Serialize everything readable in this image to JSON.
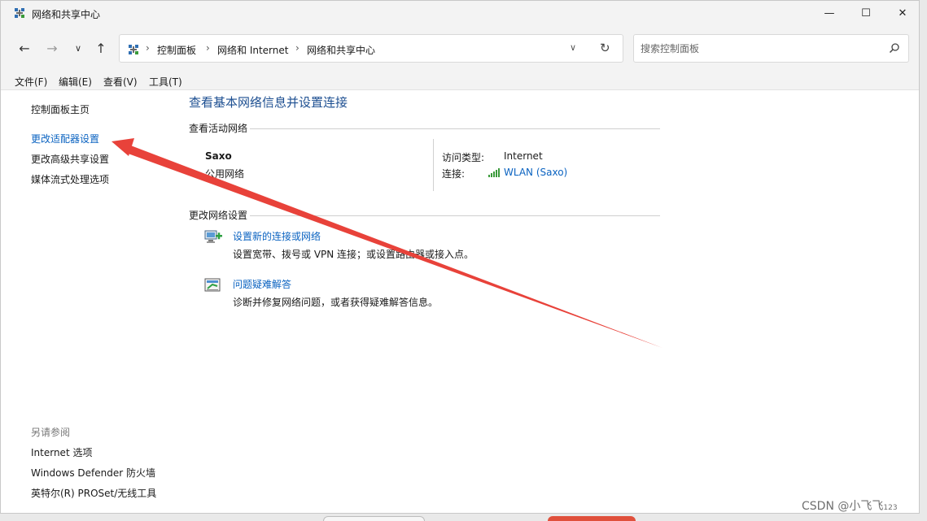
{
  "window": {
    "title": "网络和共享中心",
    "controls": {
      "minimize": "—",
      "maximize": "☐",
      "close": "✕"
    }
  },
  "nav": {
    "back_glyph": "←",
    "forward_glyph": "→",
    "recent_glyph": "∨",
    "up_glyph": "↑",
    "breadcrumbs": [
      "控制面板",
      "网络和 Internet",
      "网络和共享中心"
    ],
    "breadcrumb_separator": "›",
    "dropdown_glyph": "∨",
    "refresh_glyph": "↻"
  },
  "search": {
    "placeholder": "搜索控制面板"
  },
  "menu": [
    "文件(F)",
    "编辑(E)",
    "查看(V)",
    "工具(T)"
  ],
  "sidebar": {
    "links": [
      "控制面板主页",
      "更改适配器设置",
      "更改高级共享设置",
      "媒体流式处理选项"
    ],
    "see_also_title": "另请参阅",
    "see_also": [
      "Internet 选项",
      "Windows Defender 防火墙",
      "英特尔(R) PROSet/无线工具"
    ]
  },
  "main": {
    "title": "查看基本网络信息并设置连接",
    "active_networks_header": "查看活动网络",
    "network": {
      "name": "Saxo",
      "category": "公用网络",
      "access_type_label": "访问类型:",
      "access_type_value": "Internet",
      "connections_label": "连接:",
      "connections_value": "WLAN (Saxo)"
    },
    "change_settings_header": "更改网络设置",
    "tasks": [
      {
        "title": "设置新的连接或网络",
        "description": "设置宽带、拨号或 VPN 连接；或设置路由器或接入点。",
        "icon": "new-connection-icon"
      },
      {
        "title": "问题疑难解答",
        "description": "诊断并修复网络问题，或者获得疑难解答信息。",
        "icon": "troubleshoot-icon"
      }
    ]
  },
  "watermark": {
    "text": "CSDN @小飞飞",
    "suffix": "123"
  },
  "colors": {
    "link": "#0b63c1",
    "title": "#1d4f91",
    "arrow": "#e8423a"
  }
}
